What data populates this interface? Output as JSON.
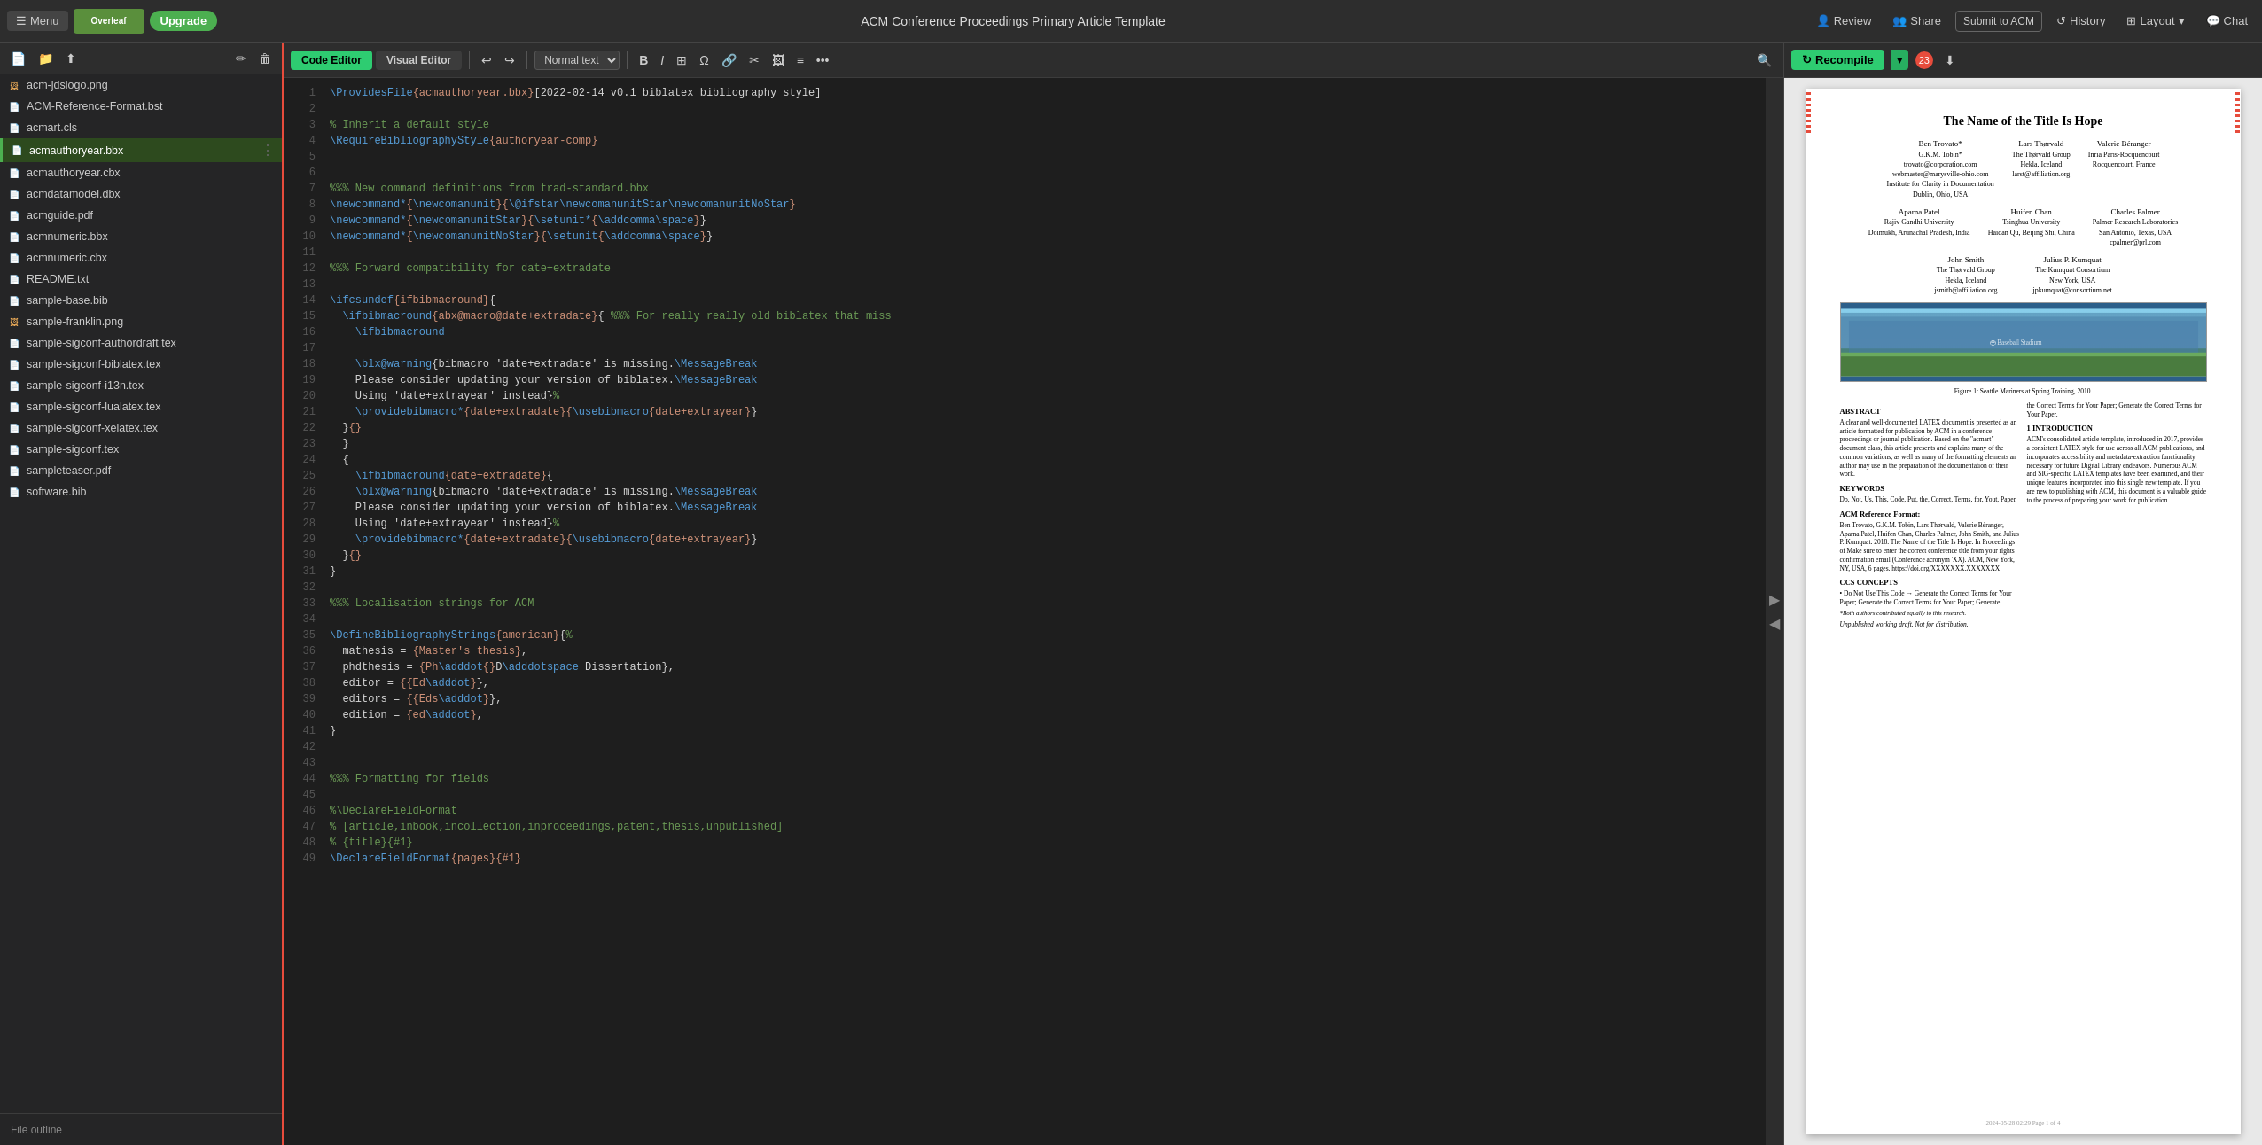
{
  "app": {
    "title": "ACM Conference Proceedings Primary Article Template",
    "menu_label": "Menu"
  },
  "topbar": {
    "upgrade_label": "Upgrade",
    "review_label": "Review",
    "share_label": "Share",
    "submit_label": "Submit to ACM",
    "history_label": "History",
    "layout_label": "Layout",
    "chat_label": "Chat"
  },
  "editor": {
    "code_tab": "Code Editor",
    "visual_tab": "Visual Editor",
    "format": "Normal text",
    "toolbar_buttons": [
      "↩",
      "↪",
      "B",
      "I",
      "⊞",
      "Ω",
      "🔗",
      "✂",
      "🖼",
      "⊟",
      "•••"
    ]
  },
  "preview": {
    "recompile_label": "Recompile",
    "badge_count": "23",
    "footer_text": "2024-05-28 02:29  Page 1 of 4"
  },
  "sidebar": {
    "files": [
      {
        "name": "acm-jdslogo.png",
        "type": "png",
        "active": false
      },
      {
        "name": "ACM-Reference-Format.bst",
        "type": "bst",
        "active": false
      },
      {
        "name": "acmart.cls",
        "type": "cls",
        "active": false
      },
      {
        "name": "acmauthoryear.bbx",
        "type": "bbx",
        "active": true,
        "highlighted": true
      },
      {
        "name": "acmauthoryear.cbx",
        "type": "cbx",
        "active": false
      },
      {
        "name": "acmdatamodel.dbx",
        "type": "dbx",
        "active": false
      },
      {
        "name": "acmguide.pdf",
        "type": "pdf",
        "active": false
      },
      {
        "name": "acmnumeric.bbx",
        "type": "bbx",
        "active": false
      },
      {
        "name": "acmnumeric.cbx",
        "type": "cbx",
        "active": false
      },
      {
        "name": "README.txt",
        "type": "txt",
        "active": false
      },
      {
        "name": "sample-base.bib",
        "type": "bib",
        "active": false
      },
      {
        "name": "sample-franklin.png",
        "type": "png",
        "active": false
      },
      {
        "name": "sample-sigconf-authordraft.tex",
        "type": "tex",
        "active": false
      },
      {
        "name": "sample-sigconf-biblatex.tex",
        "type": "tex",
        "active": false
      },
      {
        "name": "sample-sigconf-i13n.tex",
        "type": "tex",
        "active": false
      },
      {
        "name": "sample-sigconf-lualatex.tex",
        "type": "tex",
        "active": false
      },
      {
        "name": "sample-sigconf-xelatex.tex",
        "type": "tex",
        "active": false
      },
      {
        "name": "sample-sigconf.tex",
        "type": "tex",
        "active": false
      },
      {
        "name": "sampleteaser.pdf",
        "type": "pdf",
        "active": false
      },
      {
        "name": "software.bib",
        "type": "bib",
        "active": false
      }
    ],
    "bottom_label": "File outline"
  },
  "code": {
    "lines": [
      {
        "num": 1,
        "content": "\\ProvidesFile{acmauthoryear.bbx}[2022-02-14 v0.1 biblatex bibliography style]"
      },
      {
        "num": 2,
        "content": ""
      },
      {
        "num": 3,
        "content": "% Inherit a default style"
      },
      {
        "num": 4,
        "content": "\\RequireBibliographyStyle{authoryear-comp}"
      },
      {
        "num": 5,
        "content": ""
      },
      {
        "num": 6,
        "content": ""
      },
      {
        "num": 7,
        "content": "%%% New command definitions from trad-standard.bbx"
      },
      {
        "num": 8,
        "content": "\\newcommand*{\\newcomanunit}{\\@ifstar\\newcomanunitStar\\newcomanunitNoStar}"
      },
      {
        "num": 9,
        "content": "\\newcommand*{\\newcomanunitStar}{\\setunit*{\\addcomma\\space}}"
      },
      {
        "num": 10,
        "content": "\\newcommand*{\\newcomanunitNoStar}{\\setunit{\\addcomma\\space}}"
      },
      {
        "num": 11,
        "content": ""
      },
      {
        "num": 12,
        "content": "%%% Forward compatibility for date+extradate"
      },
      {
        "num": 13,
        "content": ""
      },
      {
        "num": 14,
        "content": "\\ifcsundef{ifbibmacround}{"
      },
      {
        "num": 15,
        "content": "  \\ifbibmacround{abx@macro@date+extradate}{ %%% For really really old biblatex that miss"
      },
      {
        "num": 16,
        "content": "    \\ifbibmacround"
      },
      {
        "num": 17,
        "content": ""
      },
      {
        "num": 18,
        "content": "    \\blx@warning{bibmacro 'date+extradate' is missing.\\MessageBreak"
      },
      {
        "num": 19,
        "content": "    Please consider updating your version of biblatex.\\MessageBreak"
      },
      {
        "num": 20,
        "content": "    Using 'date+extrayear' instead}%"
      },
      {
        "num": 21,
        "content": "    \\providebibmacro*{date+extradate}{\\usebibmacro{date+extrayear}}"
      },
      {
        "num": 22,
        "content": "  }{}"
      },
      {
        "num": 23,
        "content": "  }"
      },
      {
        "num": 24,
        "content": "  {"
      },
      {
        "num": 25,
        "content": "    \\ifbibmacround{date+extradate}{"
      },
      {
        "num": 26,
        "content": "    \\blx@warning{bibmacro 'date+extradate' is missing.\\MessageBreak"
      },
      {
        "num": 27,
        "content": "    Please consider updating your version of biblatex.\\MessageBreak"
      },
      {
        "num": 28,
        "content": "    Using 'date+extrayear' instead}%"
      },
      {
        "num": 29,
        "content": "    \\providebibmacro*{date+extradate}{\\usebibmacro{date+extrayear}}"
      },
      {
        "num": 30,
        "content": "  }{}"
      },
      {
        "num": 31,
        "content": "}"
      },
      {
        "num": 32,
        "content": ""
      },
      {
        "num": 33,
        "content": "%%% Localisation strings for ACM"
      },
      {
        "num": 34,
        "content": ""
      },
      {
        "num": 35,
        "content": "\\DefineBibliographyStrings{american}{%"
      },
      {
        "num": 36,
        "content": "  mathesis = {Master's thesis},"
      },
      {
        "num": 37,
        "content": "  phdthesis = {Ph\\adddot{}D\\adddotspace Dissertation},"
      },
      {
        "num": 38,
        "content": "  editor = {{Ed\\adddot}},"
      },
      {
        "num": 39,
        "content": "  editors = {{Eds\\adddot}},"
      },
      {
        "num": 40,
        "content": "  edition = {ed\\adddot},"
      },
      {
        "num": 41,
        "content": "}"
      },
      {
        "num": 42,
        "content": ""
      },
      {
        "num": 43,
        "content": ""
      },
      {
        "num": 44,
        "content": "%%% Formatting for fields"
      },
      {
        "num": 45,
        "content": ""
      },
      {
        "num": 46,
        "content": "%\\DeclareFieldFormat"
      },
      {
        "num": 47,
        "content": "% [article,inbook,incollection,inproceedings,patent,thesis,unpublished]"
      },
      {
        "num": 48,
        "content": "% {title}{#1}"
      },
      {
        "num": 49,
        "content": "\\DeclareFieldFormat{pages}{#1}"
      }
    ]
  },
  "paper": {
    "title": "The Name of the Title Is Hope",
    "authors": [
      {
        "name": "Ben Trovato*",
        "affil1": "G.K.M. Tobin*",
        "affil2": "trovato@corporation.com",
        "affil3": "webmaster@marysville-ohio.com",
        "affil4": "Institute for Clarity in Documentation",
        "affil5": "Dublin, Ohio, USA"
      },
      {
        "name": "Lars Thorvald",
        "affil1": "The Thorvald Group",
        "affil2": "Hekla, Iceland",
        "affil3": "larst@affiliation.org"
      },
      {
        "name": "Valerie Béranger",
        "affil1": "Inria Paris-Rocquencourt",
        "affil2": "Rocquencourt, France"
      }
    ],
    "authors2": [
      {
        "name": "Aparna Patel",
        "affil1": "Rajiv Gandhi University",
        "affil2": "Doimukh, Arunachal Pradesh, India"
      },
      {
        "name": "Huifen Chan",
        "affil1": "Tsinghua University",
        "affil2": "Haidan Qu, Beijing Shi, China"
      },
      {
        "name": "Charles Palmer",
        "affil1": "Palmer Research Laboratories",
        "affil2": "San Antonio, Texas, USA",
        "affil3": "cpalmer@prl.com"
      }
    ],
    "authors3": [
      {
        "name": "John Smith",
        "affil1": "The Thorvald Group",
        "affil2": "Hekla, Iceland",
        "affil3": "jsmith@affiliation.org"
      },
      {
        "name": "Julius P. Kumquat",
        "affil1": "The Kumquat Consortium",
        "affil2": "New York, USA",
        "affil3": "jpkumquat@consortium.net"
      }
    ],
    "figure_caption": "Figure 1: Seattle Mariners at Spring Training, 2010.",
    "abstract_title": "ABSTRACT",
    "abstract_text": "A clear and well-documented LATEX document is presented as an article formatted for publication by ACM in a conference proceedings or journal publication. Based on the \"acmart\" document class, this article presents and explains many of the common variations, as well as many of the formatting elements an author may use in the preparation of the documentation of their work.",
    "abstract_text2": "the Correct Terms for Your Paper; Generate the Correct Terms for Your Paper.",
    "keywords_title": "KEYWORDS",
    "keywords_text": "Do, Not, Us, This, Code, Put, the, Correct, Terms, for, Yout, Paper",
    "ref_format_title": "ACM Reference Format:",
    "ref_format_text": "Ben Trovato, G.K.M. Tobin, Lars Thørvald, Valerie Béranger, Aparna Patel, Huifen Chan, Charles Palmer, John Smith, and Julius P. Kumquat. 2018. The Name of the Title Is Hope. In Proceedings of Make sure to enter the correct conference title from your rights confirmation email (Conference acronym 'XX). ACM, New York, NY, USA, 6 pages. https://doi.org/XXXXXXX.XXXXXXX",
    "ccs_title": "CCS CONCEPTS",
    "ccs_text": "• Do Not Use This Code → Generate the Correct Terms for Your Paper; Generate the Correct Terms for Your Paper; Generate",
    "footnote": "*Both authors contributed equally to this research.",
    "unpublished": "Unpublished working draft. Not for distribution.",
    "intro_title": "1 INTRODUCTION",
    "intro_text": "ACM's consolidated article template, introduced in 2017, provides a consistent LATEX style for use across all ACM publications, and incorporates accessibility and metadata-extraction functionality necessary for future Digital Library endeavors. Numerous ACM and SIG-specific LATEX templates have been examined, and their unique features incorporated into this single new template. If you are new to publishing with ACM, this document is a valuable guide to the process of preparing your work for publication."
  }
}
